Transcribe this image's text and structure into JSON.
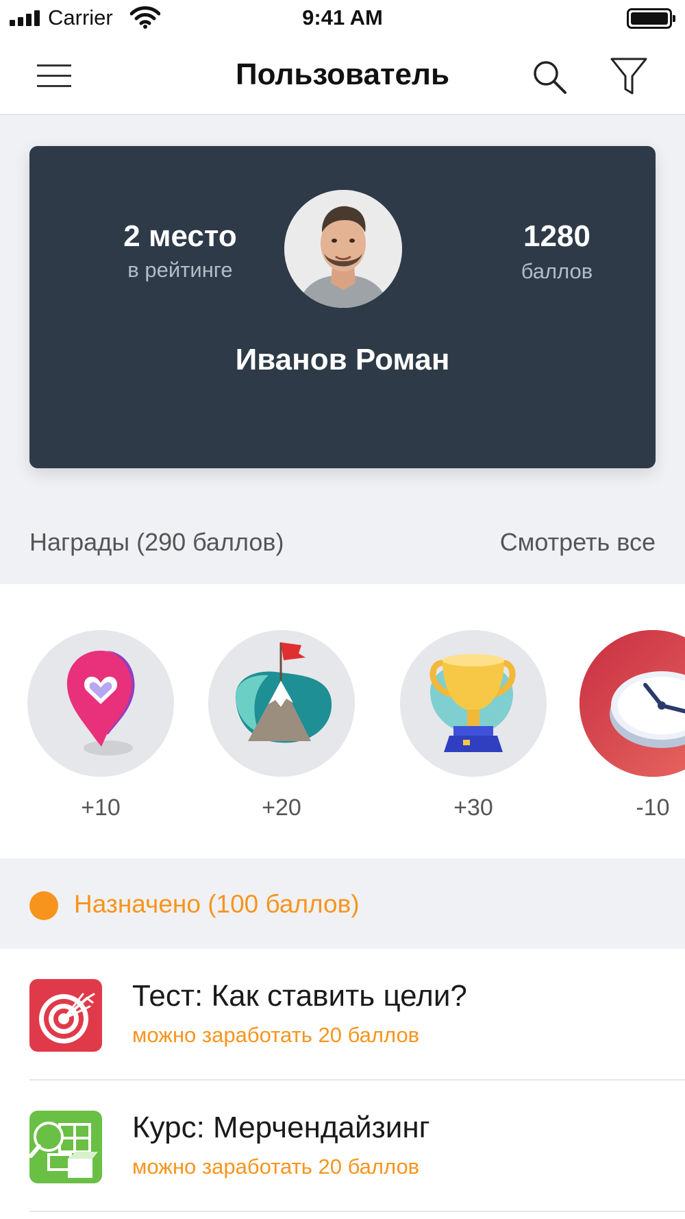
{
  "status_bar": {
    "carrier": "Carrier",
    "time": "9:41 AM",
    "icons": [
      "signal-icon",
      "wifi-icon",
      "battery-icon"
    ]
  },
  "nav": {
    "title": "Пользователь",
    "icons": [
      "hamburger-menu-icon",
      "search-icon",
      "filter-icon"
    ]
  },
  "profile": {
    "rank_value": "2 место",
    "rank_label": "в рейтинге",
    "points_value": "1280",
    "points_label": "баллов",
    "name": "Иванов Роман"
  },
  "rewards": {
    "title": "Награды (290 баллов)",
    "see_all": "Смотреть все",
    "items": [
      {
        "value": "+10",
        "icon": "heart-pin-icon"
      },
      {
        "value": "+20",
        "icon": "mountain-flag-icon"
      },
      {
        "value": "+30",
        "icon": "trophy-icon"
      },
      {
        "value": "-10",
        "icon": "clock-icon"
      }
    ]
  },
  "assigned": {
    "title": "Назначено (100 баллов)",
    "tasks": [
      {
        "title": "Тест: Как ставить цели?",
        "subtitle": "можно заработать 20 баллов",
        "icon": "target-icon"
      },
      {
        "title": "Курс: Мерчендайзинг",
        "subtitle": "можно заработать 20 баллов",
        "icon": "merchandising-icon"
      }
    ]
  },
  "colors": {
    "card_bg": "#2e3a48",
    "accent_orange": "#f7941d",
    "task1_icon_bg": "#e03a4a",
    "task2_icon_bg": "#6abf45",
    "clock_badge_bg": "#d8404e"
  }
}
